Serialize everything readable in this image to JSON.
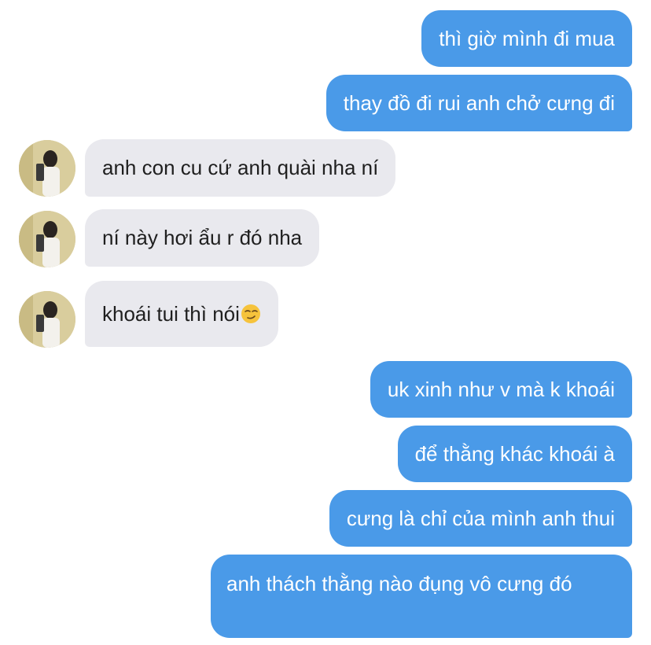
{
  "conversation": {
    "messages": [
      {
        "id": 1,
        "sender": "me",
        "text": "thì giờ mình đi mua"
      },
      {
        "id": 2,
        "sender": "me",
        "text": "thay đồ đi rui anh chở cưng đi"
      },
      {
        "id": 3,
        "sender": "other",
        "text": "anh con cu cứ anh quài nha ní"
      },
      {
        "id": 4,
        "sender": "other",
        "text": "ní này hơi ẩu r đó nha"
      },
      {
        "id": 5,
        "sender": "other",
        "text": "khoái tui thì nói",
        "emoji": "smirking-face"
      },
      {
        "id": 6,
        "sender": "me",
        "text": "uk xinh như v mà k khoái"
      },
      {
        "id": 7,
        "sender": "me",
        "text": "để thằng khác khoái à"
      },
      {
        "id": 8,
        "sender": "me",
        "text": "cưng là chỉ của mình anh thui"
      },
      {
        "id": 9,
        "sender": "me",
        "text": "anh thách thằng nào đụng vô cưng đó"
      }
    ]
  },
  "colors": {
    "sent_bubble": "#4a9ae8",
    "received_bubble": "#e9e9ee",
    "sent_text": "#ffffff",
    "received_text": "#1f1f1f"
  },
  "icons": {
    "avatar": "contact-avatar-photo",
    "emoji": "smirking-face-emoji"
  }
}
